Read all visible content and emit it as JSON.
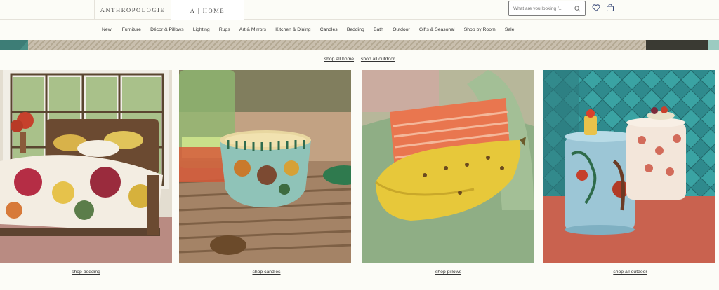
{
  "header": {
    "brand_primary": "ANTHROPOLOGIE",
    "brand_home": "A | HOME",
    "search_placeholder": "What are you looking f...",
    "icons": [
      "search-icon",
      "heart-icon",
      "bag-icon"
    ]
  },
  "nav": {
    "items": [
      "New!",
      "Furniture",
      "Décor & Pillows",
      "Lighting",
      "Rugs",
      "Art & Mirrors",
      "Kitchen & Dining",
      "Candles",
      "Bedding",
      "Bath",
      "Outdoor",
      "Gifts & Seasonal",
      "Shop by Room",
      "Sale"
    ]
  },
  "shop_links": {
    "home": "shop all home",
    "outdoor": "shop all outdoor"
  },
  "tiles": [
    {
      "caption": "shop bedding",
      "image": "bedroom-floral-duvet"
    },
    {
      "caption": "shop candles",
      "image": "ceramic-candle-on-woven-mat"
    },
    {
      "caption": "shop pillows",
      "image": "banana-crochet-pillow"
    },
    {
      "caption": "shop all outdoor",
      "image": "painted-garden-stools"
    }
  ],
  "colors": {
    "background": "#fcfcf7",
    "text": "#333333",
    "border": "#e5e2da"
  }
}
